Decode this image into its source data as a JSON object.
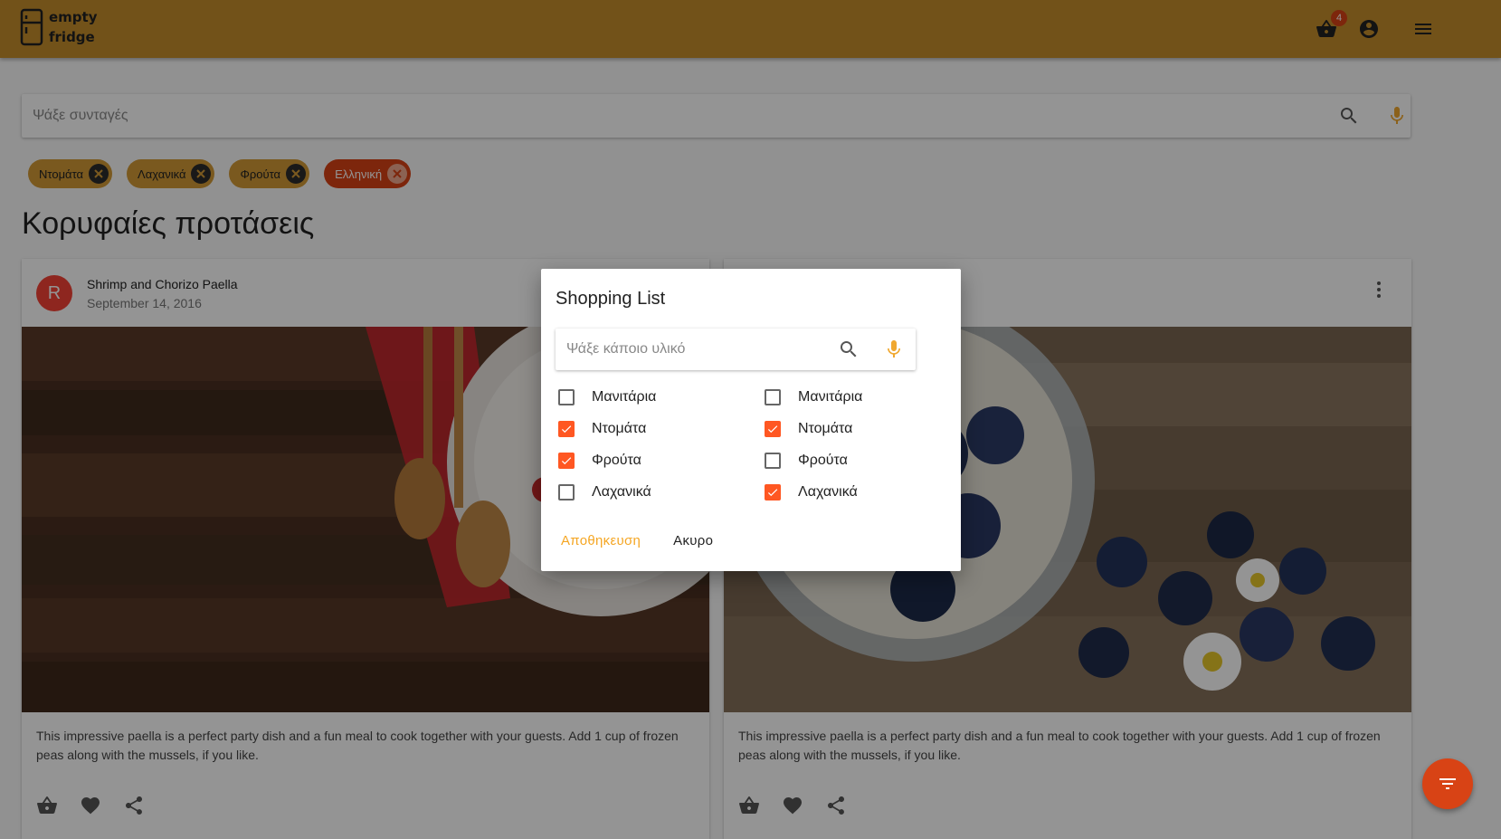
{
  "app": {
    "logo_line1": "empty",
    "logo_line2": "fridge",
    "cart_count": "4",
    "accent": "#c58d2c"
  },
  "search": {
    "placeholder": "Ψάξε συνταγές"
  },
  "chips": [
    {
      "label": "Ντομάτα",
      "color": "#d29a36"
    },
    {
      "label": "Λαχανικά",
      "color": "#d29a36"
    },
    {
      "label": "Φρούτα",
      "color": "#d29a36"
    },
    {
      "label": "Ελληνική",
      "color": "#d84315"
    }
  ],
  "section_title": "Κορυφαίες προτάσεις",
  "cards": [
    {
      "avatar": "R",
      "title": "Shrimp and Chorizo Paella",
      "date": "September 14, 2016",
      "body": "This impressive paella is a perfect party dish and a fun meal to cook together with your guests. Add 1 cup of frozen peas along with the mussels, if you like."
    },
    {
      "avatar": "",
      "title": "",
      "date": "",
      "body": "This impressive paella is a perfect party dish and a fun meal to cook together with your guests. Add 1 cup of frozen peas along with the mussels, if you like."
    }
  ],
  "dialog": {
    "title": "Shopping List",
    "search_placeholder": "Ψάξε κάποιο υλικό",
    "left_items": [
      {
        "label": "Μανιτάρια",
        "checked": false
      },
      {
        "label": "Ντομάτα",
        "checked": true
      },
      {
        "label": "Φρούτα",
        "checked": true
      },
      {
        "label": "Λαχανικά",
        "checked": false
      }
    ],
    "right_items": [
      {
        "label": "Μανιτάρια",
        "checked": false
      },
      {
        "label": "Ντομάτα",
        "checked": true
      },
      {
        "label": "Φρούτα",
        "checked": false
      },
      {
        "label": "Λαχανικά",
        "checked": true
      }
    ],
    "save_label": "Αποθηκευση",
    "cancel_label": "Ακυρο"
  },
  "icons": {
    "cart": "basket-icon",
    "account": "account-circle-icon",
    "menu": "hamburger-menu-icon",
    "search": "search-icon",
    "mic": "microphone-icon",
    "fab": "filter-icon"
  }
}
